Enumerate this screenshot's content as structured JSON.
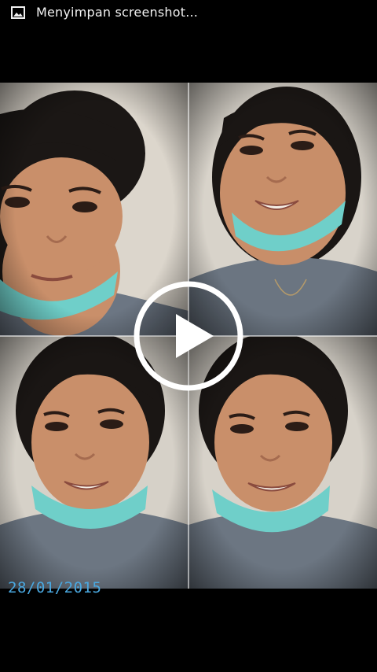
{
  "status_bar": {
    "icon": "image-icon",
    "text": "Menyimpan screenshot..."
  },
  "collage": {
    "tiles": [
      {
        "name": "selfie-1",
        "mood": "neutral"
      },
      {
        "name": "selfie-2",
        "mood": "smiling"
      },
      {
        "name": "selfie-3",
        "mood": "smiling"
      },
      {
        "name": "selfie-4",
        "mood": "smiling"
      }
    ]
  },
  "player": {
    "play_icon": "play-icon"
  },
  "date_stamp": "28/01/2015",
  "colors": {
    "background": "#000000",
    "date_stamp": "#4aa8e0",
    "mask": "#6fcfc9",
    "shirt": "#6f7a86",
    "wall": "#d9d4cc"
  }
}
